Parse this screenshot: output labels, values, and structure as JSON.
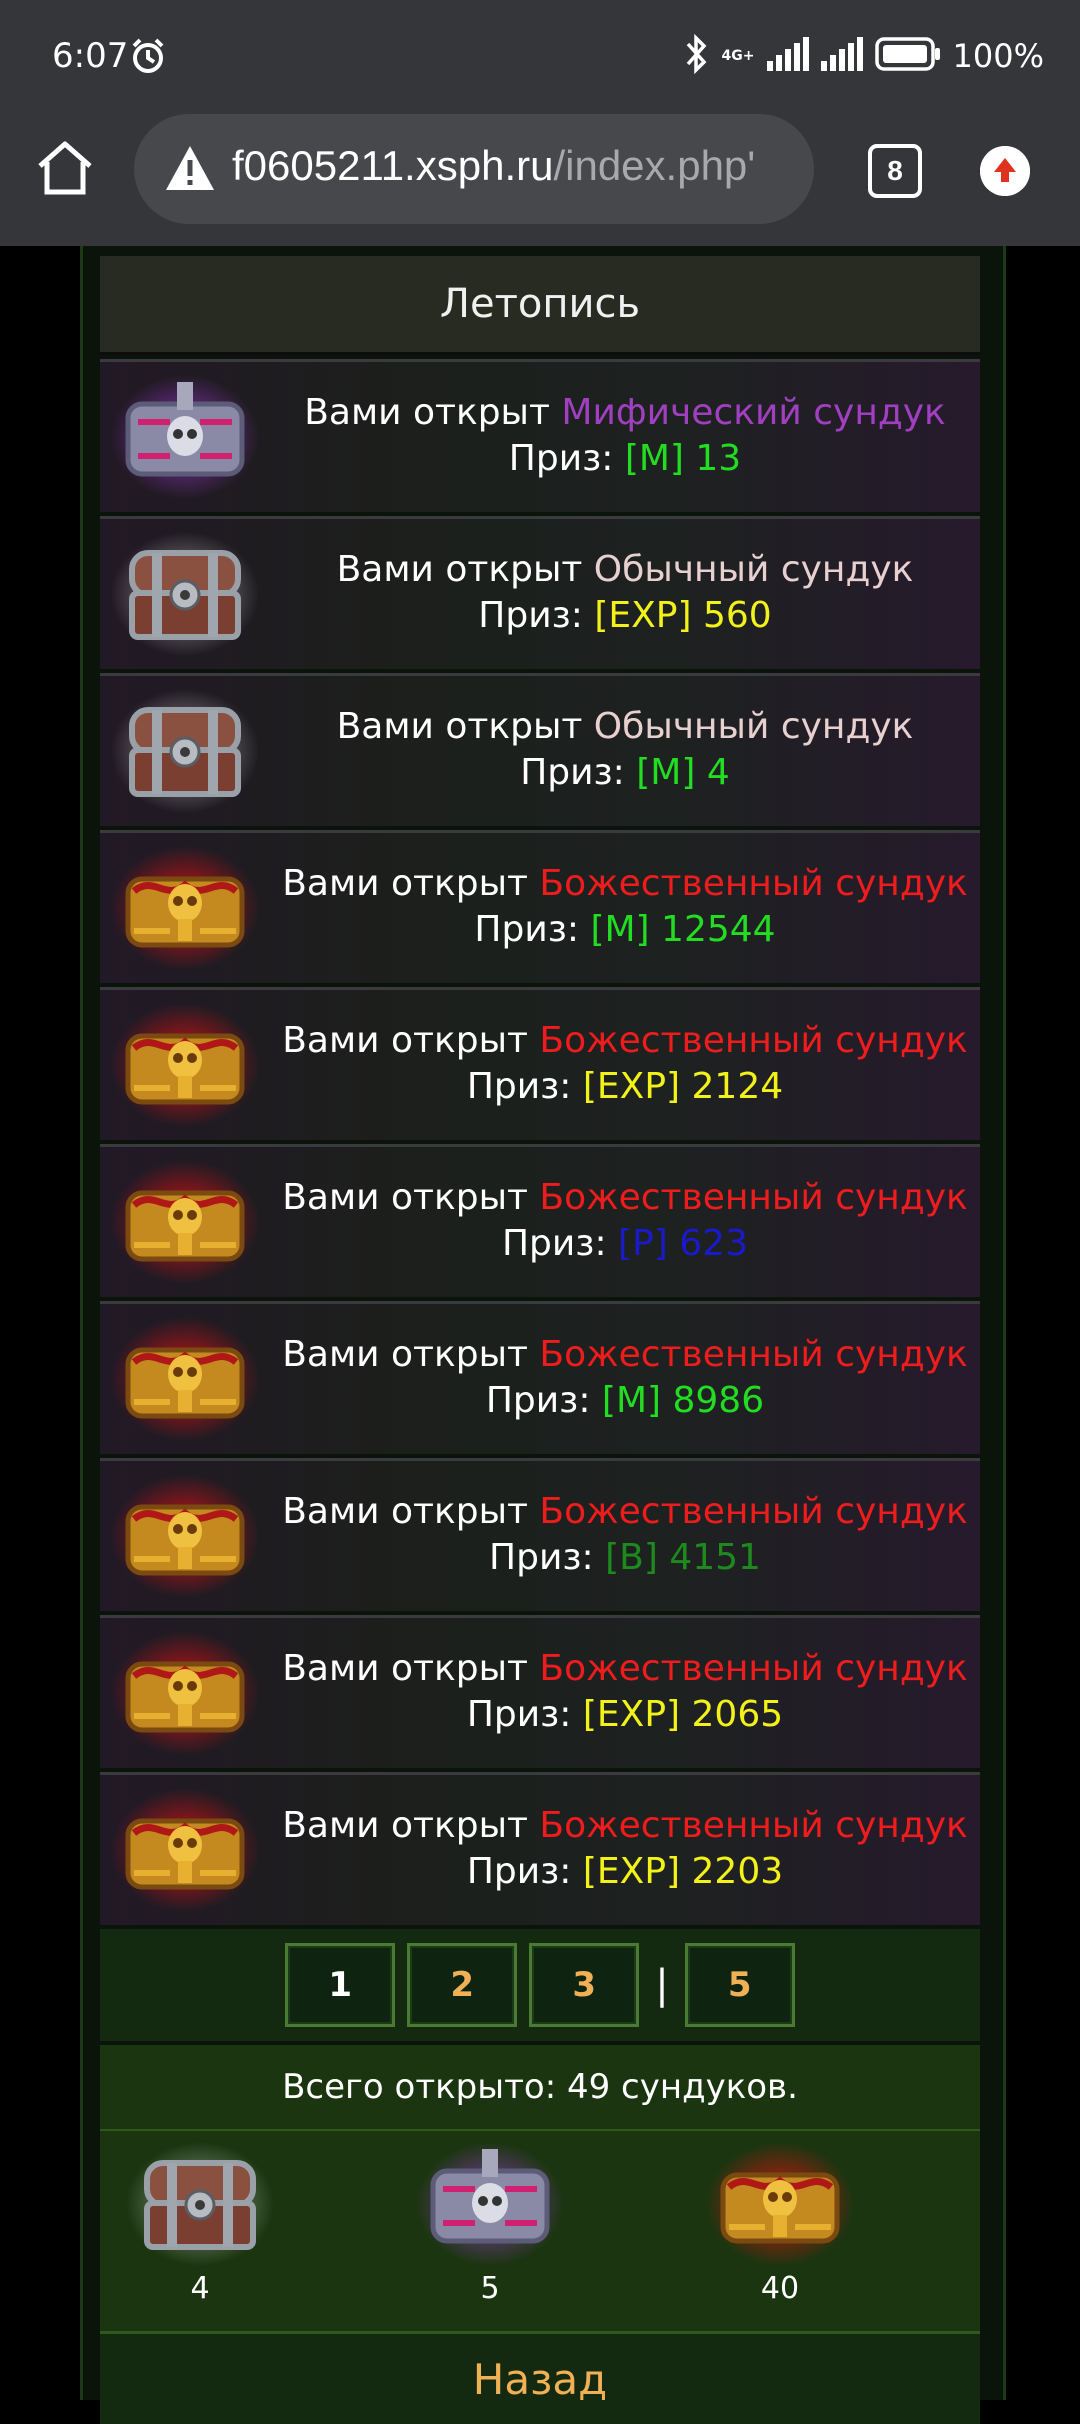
{
  "status_bar": {
    "time": "6:07",
    "network": "4G+",
    "battery": "100%"
  },
  "browser": {
    "url_host": "f0605211.xsph.ru",
    "url_path": "/index.php'",
    "tab_count": "8"
  },
  "page": {
    "title": "Летопись",
    "entries": [
      {
        "prefix": "Вами открыт ",
        "chest_name": "Мифический сундук",
        "chest_type": "mythic",
        "chest_color": "#a040c0",
        "prize_label": "Приз: ",
        "prize": "[M] 13",
        "prize_color": "#22dd22"
      },
      {
        "prefix": "Вами открыт ",
        "chest_name": "Обычный сундук",
        "chest_type": "common",
        "chest_color": "#e8d0d0",
        "prize_label": "Приз: ",
        "prize": "[EXP] 560",
        "prize_color": "#f2f21a"
      },
      {
        "prefix": "Вами открыт ",
        "chest_name": "Обычный сундук",
        "chest_type": "common",
        "chest_color": "#e8d0d0",
        "prize_label": "Приз: ",
        "prize": "[M] 4",
        "prize_color": "#22dd22"
      },
      {
        "prefix": "Вами открыт ",
        "chest_name": "Божественный сундук",
        "chest_type": "divine",
        "chest_color": "#ee1c1c",
        "prize_label": "Приз: ",
        "prize": "[M] 12544",
        "prize_color": "#22dd22"
      },
      {
        "prefix": "Вами открыт ",
        "chest_name": "Божественный сундук",
        "chest_type": "divine",
        "chest_color": "#ee1c1c",
        "prize_label": "Приз: ",
        "prize": "[EXP] 2124",
        "prize_color": "#f2f21a"
      },
      {
        "prefix": "Вами открыт ",
        "chest_name": "Божественный сундук",
        "chest_type": "divine",
        "chest_color": "#ee1c1c",
        "prize_label": "Приз: ",
        "prize": "[P] 623",
        "prize_color": "#1a1acc"
      },
      {
        "prefix": "Вами открыт ",
        "chest_name": "Божественный сундук",
        "chest_type": "divine",
        "chest_color": "#ee1c1c",
        "prize_label": "Приз: ",
        "prize": "[M] 8986",
        "prize_color": "#22dd22"
      },
      {
        "prefix": "Вами открыт ",
        "chest_name": "Божественный сундук",
        "chest_type": "divine",
        "chest_color": "#ee1c1c",
        "prize_label": "Приз: ",
        "prize": "[B] 4151",
        "prize_color": "#1e8a1e"
      },
      {
        "prefix": "Вами открыт ",
        "chest_name": "Божественный сундук",
        "chest_type": "divine",
        "chest_color": "#ee1c1c",
        "prize_label": "Приз: ",
        "prize": "[EXP] 2065",
        "prize_color": "#f2f21a"
      },
      {
        "prefix": "Вами открыт ",
        "chest_name": "Божественный сундук",
        "chest_type": "divine",
        "chest_color": "#ee1c1c",
        "prize_label": "Приз: ",
        "prize": "[EXP] 2203",
        "prize_color": "#f2f21a"
      }
    ],
    "pagination": {
      "pages": [
        {
          "label": "1",
          "current": true
        },
        {
          "label": "2",
          "current": false
        },
        {
          "label": "3",
          "current": false
        },
        {
          "label": "|",
          "separator": true
        },
        {
          "label": "5",
          "current": false
        }
      ],
      "current_color": "#ffffff",
      "other_color": "#f0b055"
    },
    "total_text": "Всего открыто: 49 сундуков.",
    "counts": [
      {
        "chest_type": "common",
        "count": "4"
      },
      {
        "chest_type": "mythic",
        "count": "5"
      },
      {
        "chest_type": "divine",
        "count": "40"
      }
    ],
    "back_label": "Назад"
  }
}
